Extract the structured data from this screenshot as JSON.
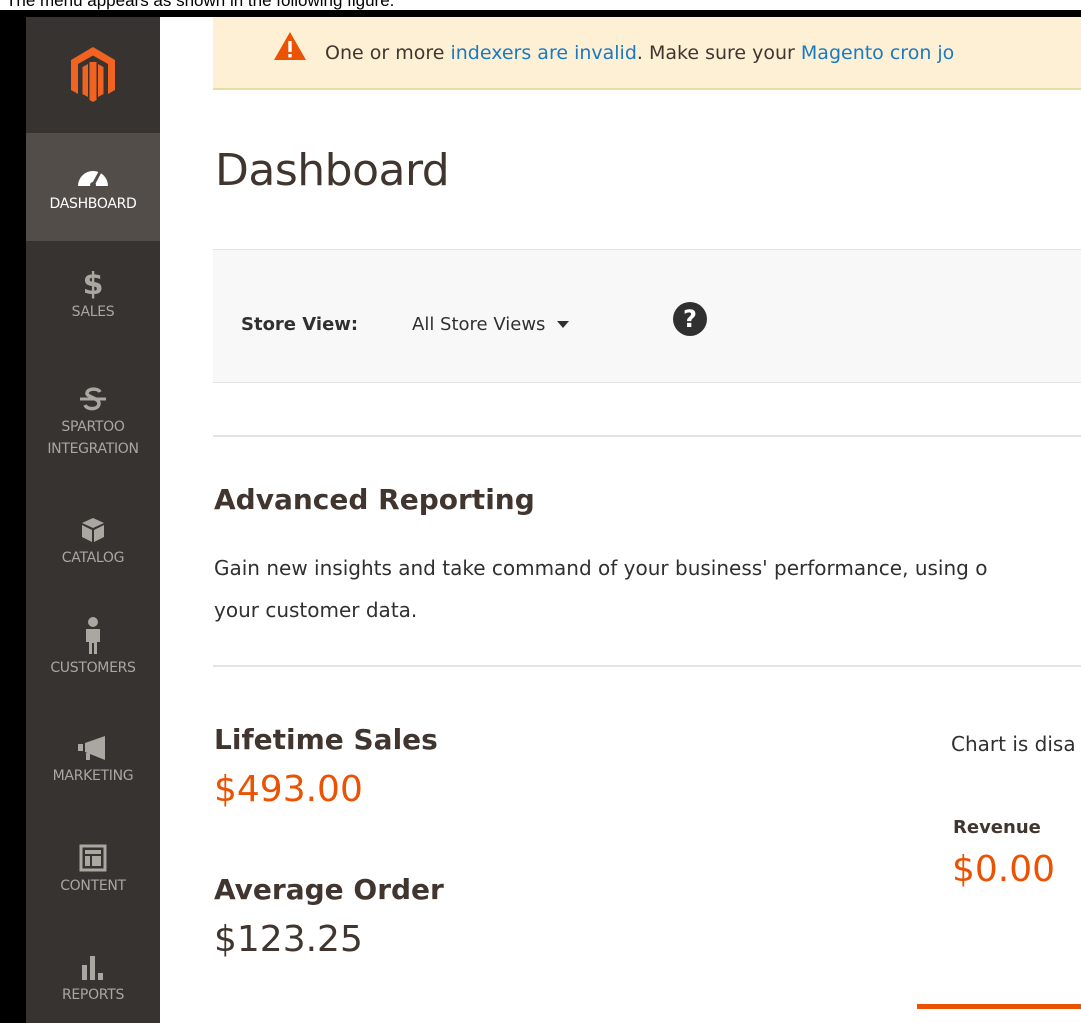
{
  "caption": "The menu appears as shown in the following figure.",
  "sidebar": {
    "items": [
      {
        "label": "DASHBOARD",
        "icon": "dashboard-gauge-icon",
        "active": true
      },
      {
        "label": "SALES",
        "icon": "dollar-icon",
        "glyph": "$"
      },
      {
        "label_line1": "SPARTOO",
        "label_line2": "INTEGRATION",
        "icon": "spartoo-icon"
      },
      {
        "label": "CATALOG",
        "icon": "cube-icon"
      },
      {
        "label": "CUSTOMERS",
        "icon": "person-icon"
      },
      {
        "label": "MARKETING",
        "icon": "megaphone-icon"
      },
      {
        "label": "CONTENT",
        "icon": "layout-icon"
      },
      {
        "label": "REPORTS",
        "icon": "bar-chart-icon"
      }
    ]
  },
  "notice": {
    "prefix": "One or more ",
    "link1": "indexers are invalid",
    "middle": ". Make sure your ",
    "link2": "Magento cron jo"
  },
  "page": {
    "title": "Dashboard"
  },
  "store_view": {
    "label": "Store View:",
    "value": "All Store Views",
    "help": "?"
  },
  "advanced_reporting": {
    "title": "Advanced Reporting",
    "text_line1": "Gain new insights and take command of your business' performance, using o",
    "text_line2": "your customer data."
  },
  "stats": {
    "lifetime_sales_label": "Lifetime Sales",
    "lifetime_sales_value": "$493.00",
    "average_order_label": "Average Order",
    "average_order_value": "$123.25"
  },
  "chart_panel": {
    "note": "Chart is disa",
    "revenue_label": "Revenue",
    "revenue_value": "$0.00"
  },
  "colors": {
    "sidebar_bg": "#373330",
    "sidebar_active_bg": "#524d49",
    "accent_orange": "#eb5202",
    "link_blue": "#1979c3",
    "notice_bg": "#fdf0d5"
  }
}
